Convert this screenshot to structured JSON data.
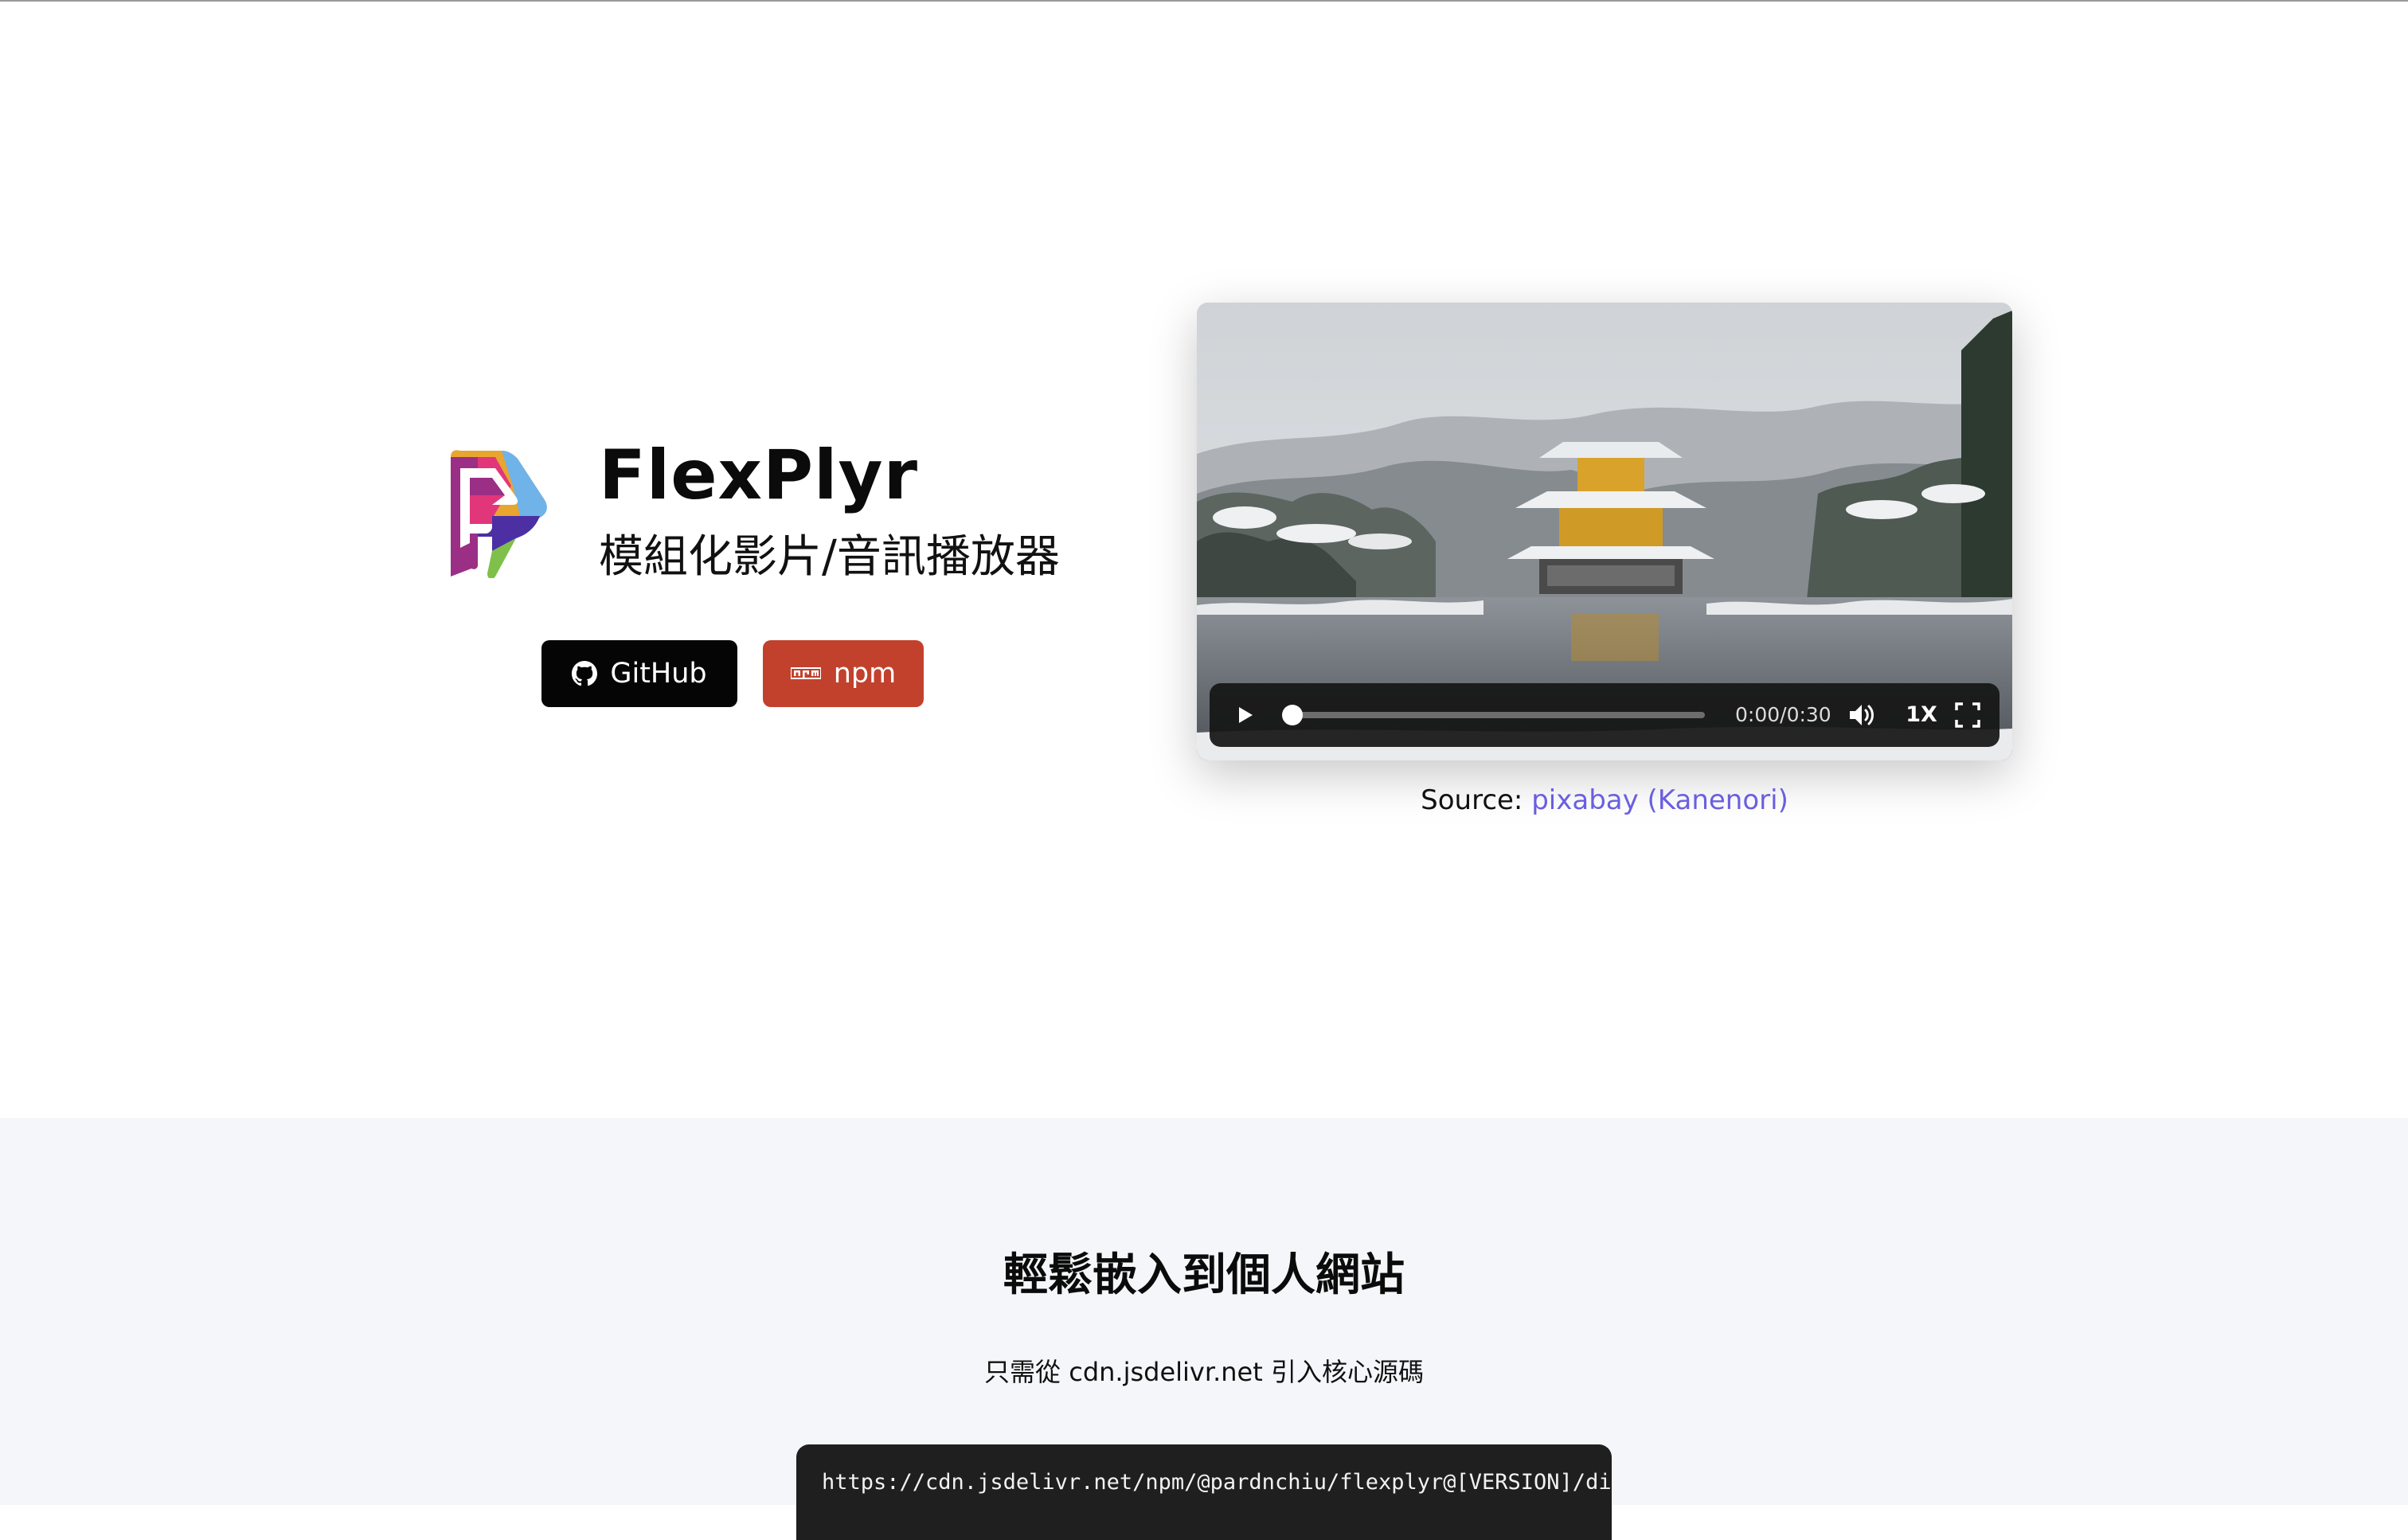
{
  "hero": {
    "title": "FlexPlyr",
    "subtitle": "模組化影片/音訊播放器",
    "buttons": {
      "github_label": "GitHub",
      "npm_label": "npm",
      "github_color": "#050505",
      "npm_color": "#c2412d"
    }
  },
  "player": {
    "state": "paused",
    "time": "0:00/0:30",
    "progress_fraction": 0.0,
    "speed": "1X",
    "icons": [
      "play-icon",
      "volume-icon",
      "fullscreen-icon"
    ]
  },
  "source": {
    "prefix": "Source:",
    "link_text": "pixabay (Kanenori)",
    "link_color": "#6a5fe0"
  },
  "embed": {
    "title": "輕鬆嵌入到個人網站",
    "description": "只需從 cdn.jsdelivr.net 引入核心源碼",
    "code": "https://cdn.jsdelivr.net/npm/@pardnchiu/flexplyr@[VERSION]/dist/"
  }
}
